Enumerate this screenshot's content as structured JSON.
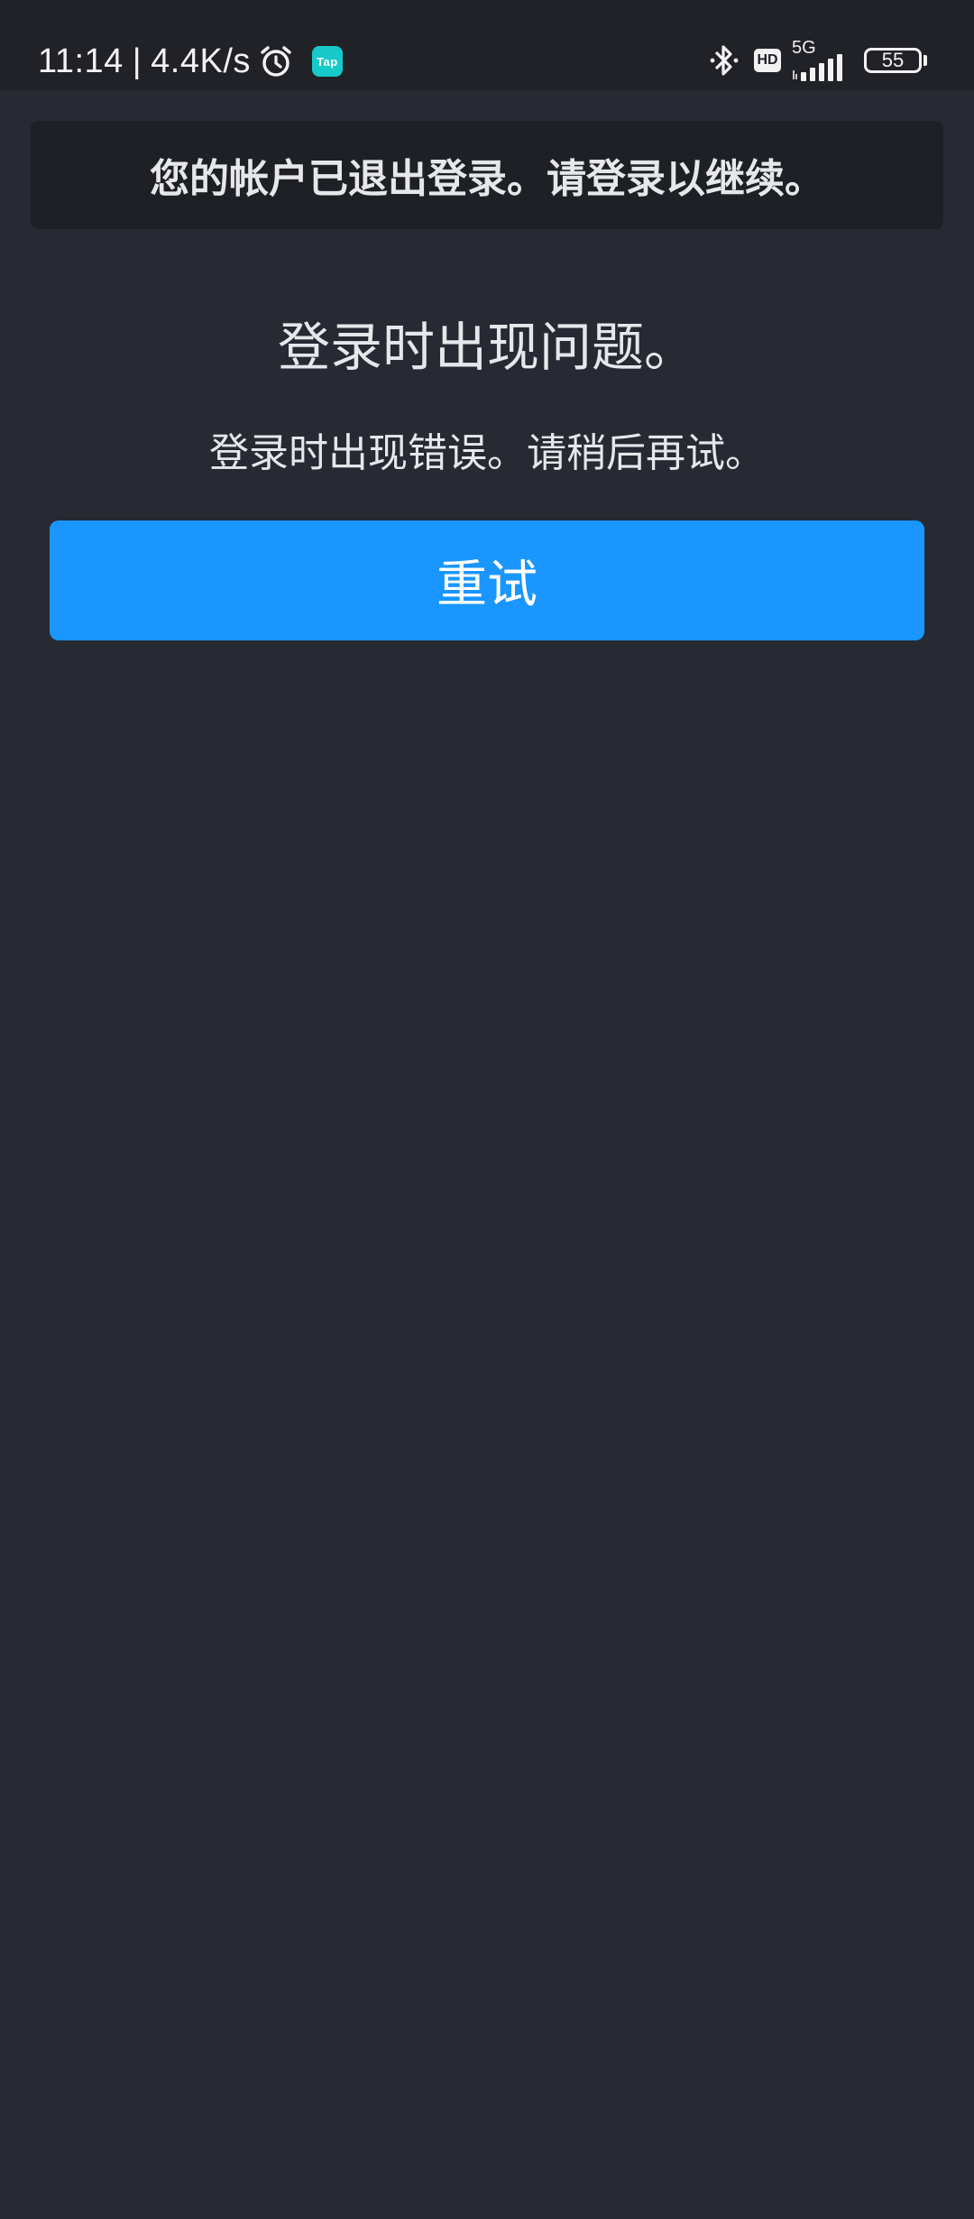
{
  "status_bar": {
    "time": "11:14",
    "separator": "|",
    "network_speed": "4.4K/s",
    "tap_app_label": "Tap",
    "hd_label": "HD",
    "network_type": "5G",
    "battery_level": "55",
    "icons": [
      "alarm-icon",
      "tap-app-icon",
      "bluetooth-icon",
      "hd-icon",
      "signal-icon",
      "battery-icon"
    ]
  },
  "banner": {
    "text": "您的帐户已退出登录。请登录以继续。"
  },
  "error": {
    "title": "登录时出现问题。",
    "message": "登录时出现错误。请稍后再试。"
  },
  "actions": {
    "retry_label": "重试"
  },
  "colors": {
    "background": "#282a33",
    "status_bar": "#212227",
    "banner": "#1f2025",
    "primary_button": "#1996ff",
    "tap_icon": "#18c9c9"
  }
}
